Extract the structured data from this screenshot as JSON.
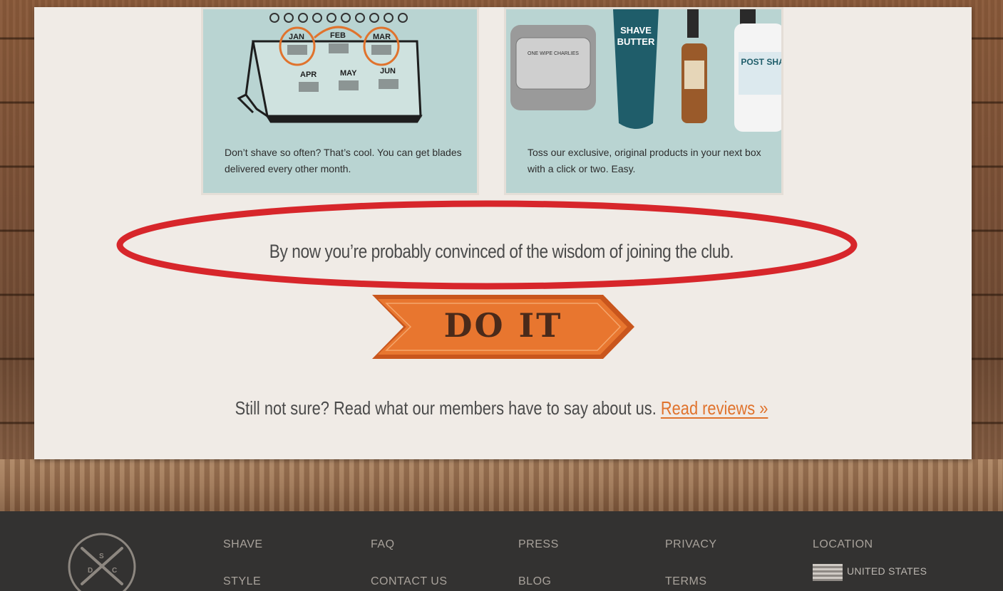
{
  "cards": [
    {
      "text": "Don’t shave so often? That’s cool. You can get blades delivered every other month.",
      "months": [
        "JAN",
        "FEB",
        "MAR",
        "APR",
        "MAY",
        "JUN"
      ]
    },
    {
      "text": "Toss our exclusive, original products in your next box with a click or two. Easy.",
      "product_labels": [
        "SHAVE",
        "BUTTER",
        "POST SHA",
        "ONE WIPE CHARLIES"
      ]
    }
  ],
  "headline": "By now you’re probably convinced of the wisdom of joining the club.",
  "cta": {
    "label": "DO IT",
    "color": "#e8762f"
  },
  "reviews": {
    "prefix": "Still not sure? Read what our members have to say about us.",
    "link": "Read reviews »"
  },
  "footer": {
    "logo_letters": [
      "D",
      "S",
      "C"
    ],
    "columns": [
      [
        "SHAVE",
        "STYLE"
      ],
      [
        "FAQ",
        "CONTACT US"
      ],
      [
        "PRESS",
        "BLOG"
      ],
      [
        "PRIVACY",
        "TERMS"
      ]
    ],
    "location_label": "LOCATION",
    "country": "UNITED STATES"
  },
  "colors": {
    "accent": "#e0732d",
    "card_bg": "#b9d4d2",
    "panel_bg": "#f0ebe6",
    "footer_bg": "#333231",
    "highlight_ellipse": "#d7262b"
  }
}
